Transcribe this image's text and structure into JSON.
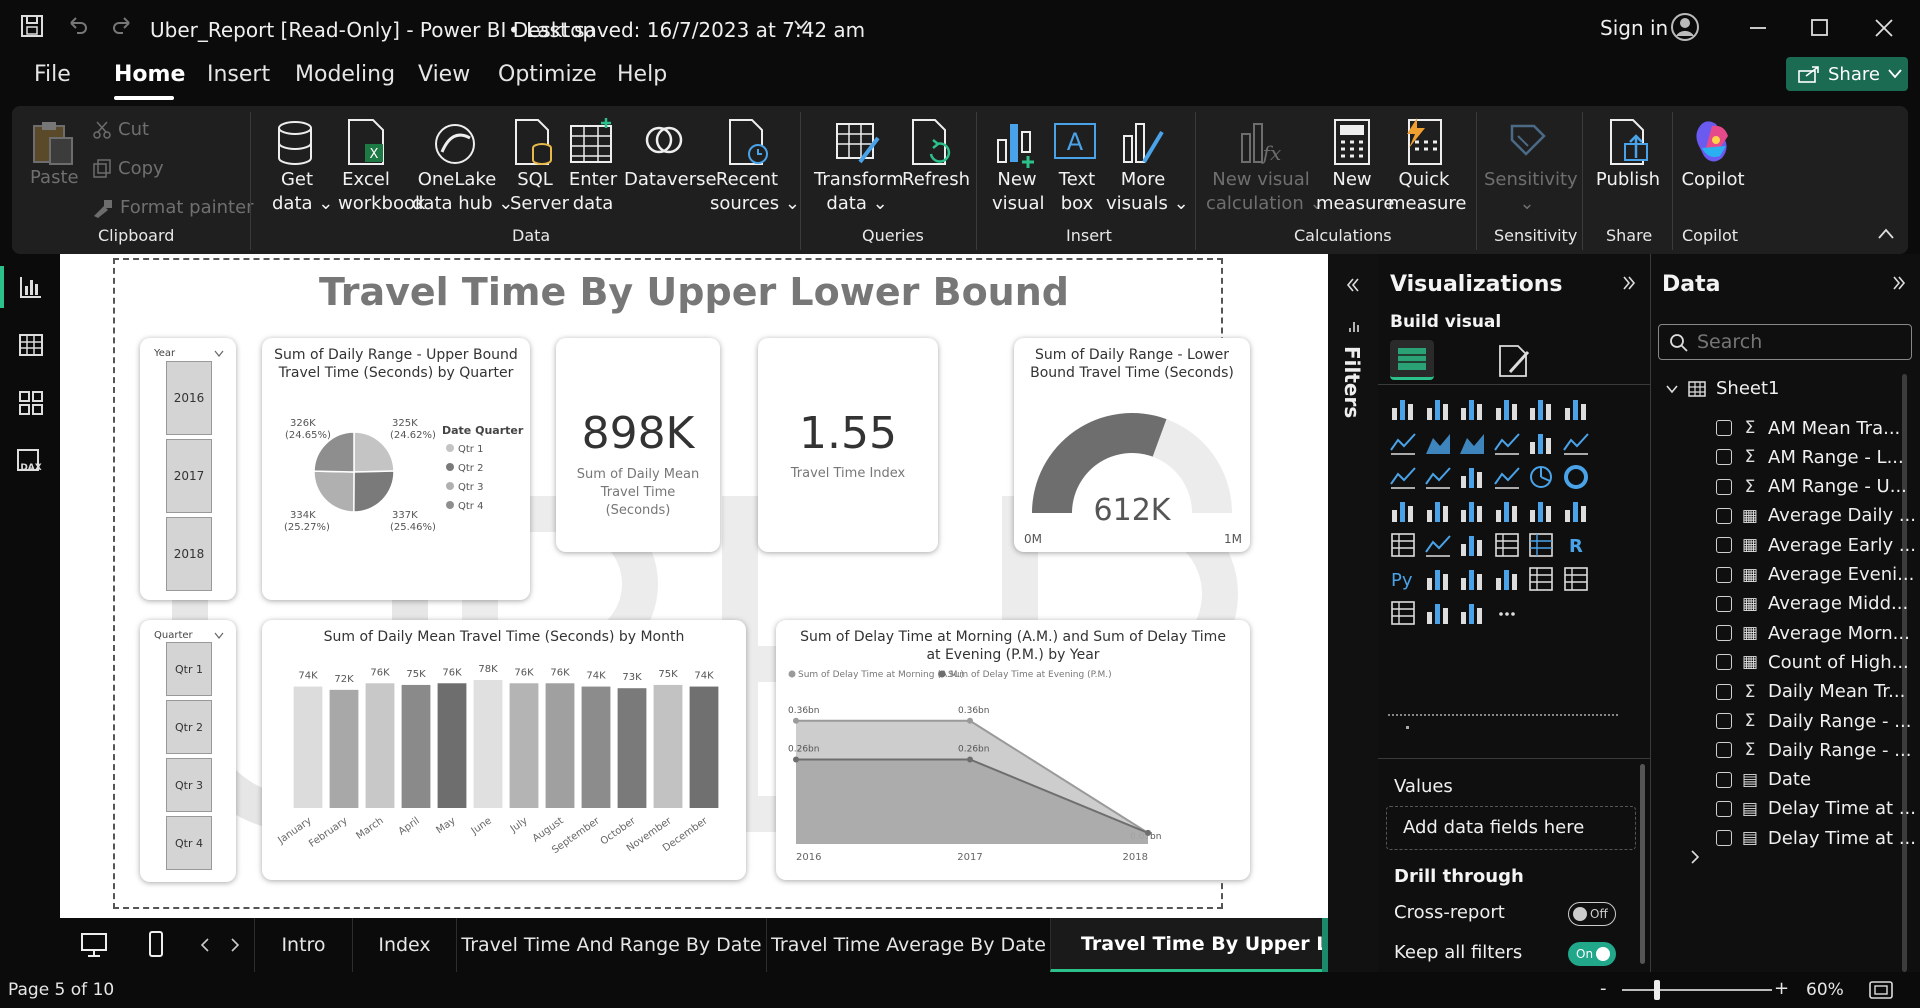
{
  "titlebar": {
    "title": "Uber_Report [Read-Only] - Power BI Desktop",
    "saved": "•  Last saved: 16/7/2023 at 7:42 am",
    "sign_in": "Sign in"
  },
  "menu": {
    "file": "File",
    "home": "Home",
    "insert": "Insert",
    "modeling": "Modeling",
    "view": "View",
    "optimize": "Optimize",
    "help": "Help",
    "share": "Share"
  },
  "ribbon": {
    "paste": "Paste",
    "cut": "Cut",
    "copy": "Copy",
    "format_painter": "Format painter",
    "get_data": [
      "Get",
      "data"
    ],
    "excel": [
      "Excel",
      "workbook"
    ],
    "onelake": [
      "OneLake",
      "data hub"
    ],
    "sql": [
      "SQL",
      "Server"
    ],
    "enter": [
      "Enter",
      "data"
    ],
    "dataverse": "Dataverse",
    "recent": [
      "Recent",
      "sources"
    ],
    "transform": [
      "Transform",
      "data"
    ],
    "refresh": "Refresh",
    "new_visual": [
      "New",
      "visual"
    ],
    "text_box": [
      "Text",
      "box"
    ],
    "more_visuals": [
      "More",
      "visuals"
    ],
    "new_visual_calc": [
      "New visual",
      "calculation"
    ],
    "new_measure": [
      "New",
      "measure"
    ],
    "quick_measure": [
      "Quick",
      "measure"
    ],
    "sensitivity": "Sensitivity",
    "publish": "Publish",
    "copilot": "Copilot",
    "groups": {
      "clipboard": "Clipboard",
      "data": "Data",
      "queries": "Queries",
      "insert": "Insert",
      "calculations": "Calculations",
      "sensitivity": "Sensitivity",
      "share": "Share",
      "copilot": "Copilot"
    }
  },
  "report": {
    "title": "Travel Time By Upper Lower Bound",
    "watermark": "UBER",
    "year_slicer": {
      "header": "Year",
      "items": [
        "2016",
        "2017",
        "2018"
      ]
    },
    "quarter_slicer": {
      "header": "Quarter",
      "items": [
        "Qtr 1",
        "Qtr 2",
        "Qtr 3",
        "Qtr 4"
      ]
    },
    "pie": {
      "title": "Sum of Daily Range - Upper Bound Travel Time (Seconds) by Quarter",
      "legend_title": "Date Quarter",
      "slices": [
        {
          "label": "Qtr 1",
          "value": "325K",
          "pct": "(24.62%)",
          "share": 24.62,
          "color": "#c4c4c4"
        },
        {
          "label": "Qtr 2",
          "value": "337K",
          "pct": "(25.46%)",
          "share": 25.46,
          "color": "#7a7a7a"
        },
        {
          "label": "Qtr 3",
          "value": "334K",
          "pct": "(25.27%)",
          "share": 25.27,
          "color": "#b0b0b0"
        },
        {
          "label": "Qtr 4",
          "value": "326K",
          "pct": "(24.65%)",
          "share": 24.65,
          "color": "#8e8e8e"
        }
      ]
    },
    "card1": {
      "value": "898K",
      "label": "Sum of Daily Mean Travel Time (Seconds)"
    },
    "card2": {
      "value": "1.55",
      "label": "Travel Time Index"
    },
    "gauge": {
      "title": "Sum of Daily Range - Lower Bound Travel Time (Seconds)",
      "value": "612K",
      "min": "0M",
      "max": "1M",
      "fraction": 0.612
    },
    "bar": {
      "title": "Sum of Daily Mean Travel Time (Seconds) by Month"
    },
    "area": {
      "title": "Sum of Delay Time at Morning (A.M.) and Sum of Delay Time at Evening (P.M.) by Year"
    }
  },
  "chart_data": [
    {
      "type": "bar",
      "title": "Sum of Daily Mean Travel Time (Seconds) by Month",
      "categories": [
        "January",
        "February",
        "March",
        "April",
        "May",
        "June",
        "July",
        "August",
        "September",
        "October",
        "November",
        "December"
      ],
      "values": [
        74,
        72,
        76,
        75,
        76,
        78,
        76,
        76,
        74,
        73,
        75,
        74
      ],
      "data_labels": [
        "74K",
        "72K",
        "76K",
        "75K",
        "76K",
        "78K",
        "76K",
        "76K",
        "74K",
        "73K",
        "75K",
        "74K"
      ],
      "colors": [
        "#dcdcdc",
        "#a8a8a8",
        "#c8c8c8",
        "#8a8a8a",
        "#6e6e6e",
        "#e0e0e0",
        "#b4b4b4",
        "#a0a0a0",
        "#8c8c8c",
        "#7a7a7a",
        "#c2c2c2",
        "#707070"
      ],
      "ylim": [
        0,
        78
      ]
    },
    {
      "type": "area",
      "title": "Sum of Delay Time at Morning (A.M.) and Sum of Delay Time at Evening (P.M.) by Year",
      "x": [
        "2016",
        "2017",
        "2018"
      ],
      "series": [
        {
          "name": "Sum of Delay Time at Morning (A.M.)",
          "values": [
            0.36,
            0.36,
            0.07
          ],
          "labels": [
            "0.36bn",
            "0.36bn",
            "0.07bn"
          ],
          "color": "#9a9a9a"
        },
        {
          "name": "Sum of Delay Time at Evening (P.M.)",
          "values": [
            0.26,
            0.26,
            0.07
          ],
          "labels": [
            "0.26bn",
            "0.26bn",
            ""
          ],
          "color": "#6e6e6e"
        }
      ],
      "ylim": [
        0,
        0.4
      ]
    },
    {
      "type": "pie",
      "title": "Sum of Daily Range - Upper Bound Travel Time (Seconds) by Quarter",
      "categories": [
        "Qtr 1",
        "Qtr 2",
        "Qtr 3",
        "Qtr 4"
      ],
      "values": [
        325,
        337,
        334,
        326
      ]
    }
  ],
  "tabs": [
    "Intro",
    "Index",
    "Travel Time And Range By Date",
    "Travel Time Average By Date",
    "Travel Time By Upper Lower B"
  ],
  "status": {
    "page": "Page 5 of 10",
    "zoom": "60%",
    "minus": "-",
    "plus": "+"
  },
  "filters": {
    "label": "Filters"
  },
  "visualizations": {
    "title": "Visualizations",
    "build": "Build visual",
    "values": "Values",
    "add_fields": "Add data fields here",
    "drill": "Drill through",
    "cross_report": "Cross-report",
    "cross_state": "Off",
    "keep_filters": "Keep all filters",
    "keep_state": "On",
    "more": "..."
  },
  "data_pane": {
    "title": "Data",
    "search_placeholder": "Search",
    "table": "Sheet1",
    "fields": [
      {
        "name": "AM Mean Tra...",
        "kind": "sigma"
      },
      {
        "name": "AM Range - L...",
        "kind": "sigma"
      },
      {
        "name": "AM Range - U...",
        "kind": "sigma"
      },
      {
        "name": "Average Daily ...",
        "kind": "calc"
      },
      {
        "name": "Average Early ...",
        "kind": "calc"
      },
      {
        "name": "Average Eveni...",
        "kind": "calc"
      },
      {
        "name": "Average Midd...",
        "kind": "calc"
      },
      {
        "name": "Average Morn...",
        "kind": "calc"
      },
      {
        "name": "Count of High...",
        "kind": "calc"
      },
      {
        "name": "Daily Mean Tr...",
        "kind": "sigma"
      },
      {
        "name": "Daily Range - ...",
        "kind": "sigma"
      },
      {
        "name": "Daily Range - ...",
        "kind": "sigma"
      },
      {
        "name": "Date",
        "kind": "table"
      },
      {
        "name": "Delay Time at ...",
        "kind": "table"
      },
      {
        "name": "Delay Time at ...",
        "kind": "table"
      }
    ]
  },
  "colors": {
    "accent": "#1b6b52",
    "toggle_on": "#21a88a",
    "ribbon": "#1f1f1f"
  }
}
